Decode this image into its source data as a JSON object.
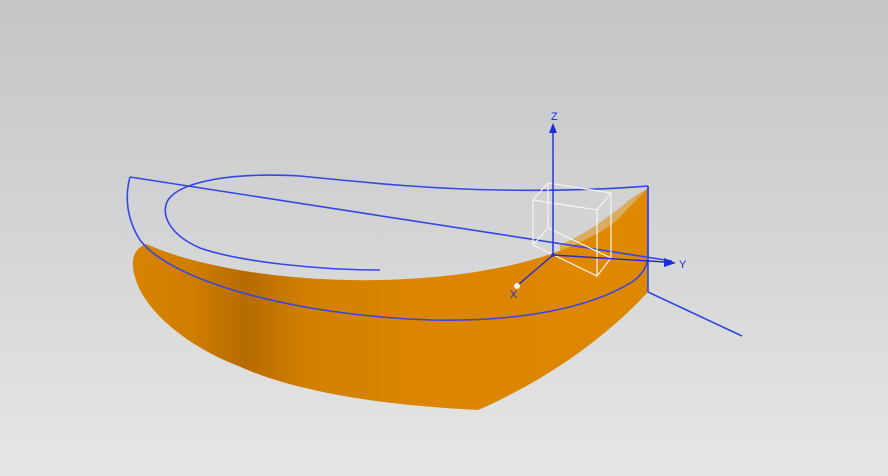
{
  "viewport": {
    "background_top": "#c3c5c7",
    "background_bottom": "#e6e6e6"
  },
  "model": {
    "surface_color": "#dd8500",
    "surface_shadow_color": "#b36a00",
    "wireframe_color": "#3546e6"
  },
  "triad": {
    "color": "#1e2bd6",
    "x_label": "X",
    "y_label": "Y",
    "z_label": "Z"
  }
}
